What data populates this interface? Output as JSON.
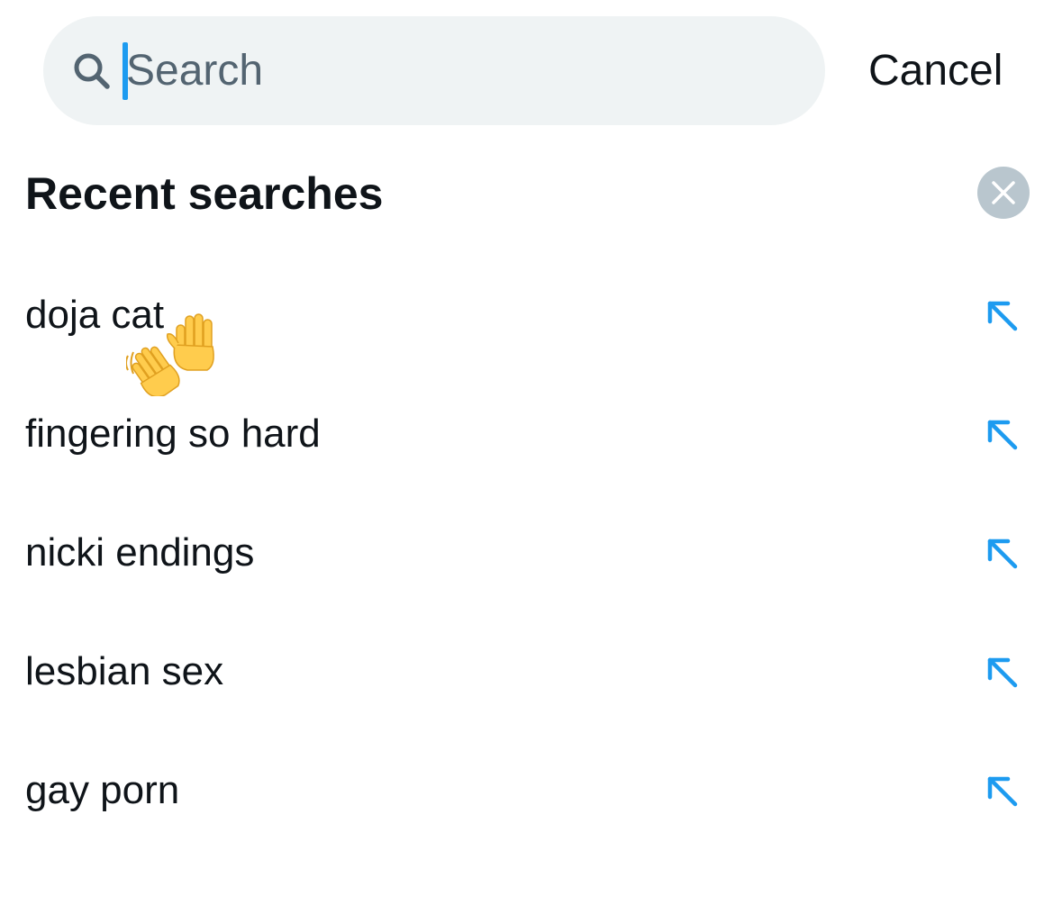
{
  "search": {
    "placeholder": "Search",
    "value": "",
    "cancel_label": "Cancel"
  },
  "recent": {
    "title": "Recent searches",
    "items": [
      {
        "label": "doja cat"
      },
      {
        "label": "fingering so hard"
      },
      {
        "label": "nicki endings"
      },
      {
        "label": "lesbian sex"
      },
      {
        "label": "gay porn"
      }
    ]
  },
  "icons": {
    "search": "search-icon",
    "clear": "close-icon",
    "fill": "arrow-up-left-icon",
    "sticker": "waving-hands-icon"
  },
  "colors": {
    "accent": "#1d9bf0",
    "text_primary": "#0f1419",
    "text_secondary": "#536471",
    "pill_background": "#eff3f4",
    "clear_button": "#b9c6ce",
    "emoji_yellow": "#ffcc4d"
  }
}
